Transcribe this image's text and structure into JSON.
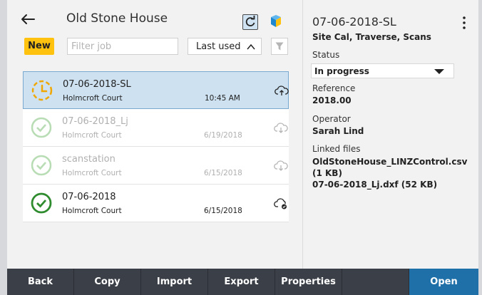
{
  "header": {
    "title": "Old Stone House"
  },
  "toolbar": {
    "new_label": "New",
    "filter_placeholder": "Filter job",
    "sort_value": "Last used"
  },
  "jobs": [
    {
      "name": "07-06-2018-SL",
      "location": "Holmcroft Court",
      "date": "10:45 AM",
      "status": "in-progress",
      "selected": true
    },
    {
      "name": "07-06-2018_Lj",
      "location": "Holmcroft Court",
      "date": "6/19/2018",
      "status": "done-dim"
    },
    {
      "name": "scanstation",
      "location": "Holmcroft Court",
      "date": "6/15/2018",
      "status": "done-dim"
    },
    {
      "name": "07-06-2018",
      "location": "Holmcroft Court",
      "date": "6/15/2018",
      "status": "done"
    }
  ],
  "details": {
    "title": "07-06-2018-SL",
    "subtitle": "Site Cal, Traverse, Scans",
    "status_label": "Status",
    "status_value": "In progress",
    "reference_label": "Reference",
    "reference_value": "2018.00",
    "operator_label": "Operator",
    "operator_value": "Sarah Lind",
    "linked_label": "Linked files",
    "linked_files": "OldStoneHouse_LINZControl.csv (1 KB)\n07-06-2018_Lj.dxf (52 KB)"
  },
  "bottom_bar": {
    "back": "Back",
    "copy": "Copy",
    "import": "Import",
    "export": "Export",
    "properties": "Properties",
    "blank": "",
    "open": "Open"
  },
  "colors": {
    "accent_yellow": "#ffc20e",
    "selected_row": "#cde1f1",
    "done_green": "#2e8b2e",
    "open_blue": "#1f6fa8",
    "bottom_bar": "#3b3f47"
  }
}
